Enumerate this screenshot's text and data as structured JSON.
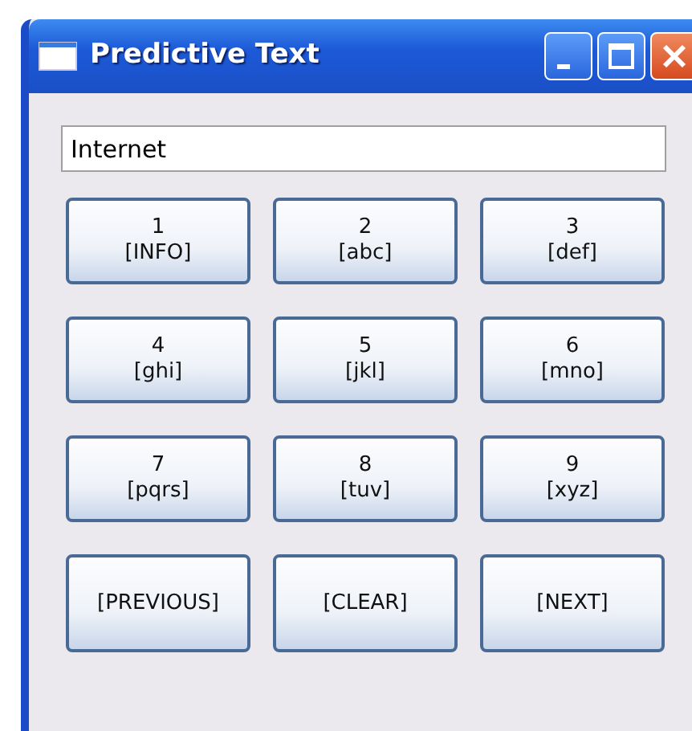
{
  "window": {
    "title": "Predictive Text"
  },
  "input": {
    "value": "Internet"
  },
  "keys": [
    {
      "lines": [
        "1",
        "[INFO]"
      ]
    },
    {
      "lines": [
        "2",
        "[abc]"
      ]
    },
    {
      "lines": [
        "3",
        "[def]"
      ]
    },
    {
      "lines": [
        "4",
        "[ghi]"
      ]
    },
    {
      "lines": [
        "5",
        "[jkl]"
      ]
    },
    {
      "lines": [
        "6",
        "[mno]"
      ]
    },
    {
      "lines": [
        "7",
        "[pqrs]"
      ]
    },
    {
      "lines": [
        "8",
        "[tuv]"
      ]
    },
    {
      "lines": [
        "9",
        "[xyz]"
      ]
    },
    {
      "lines": [
        "[PREVIOUS]"
      ]
    },
    {
      "lines": [
        "[CLEAR]"
      ]
    },
    {
      "lines": [
        "[NEXT]"
      ]
    }
  ]
}
